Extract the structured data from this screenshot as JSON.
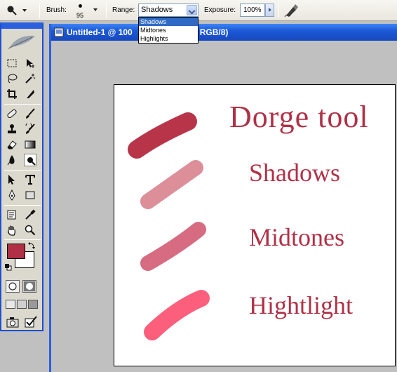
{
  "options_bar": {
    "tool_preset_icon": "dodge-tool-icon",
    "brush_label": "Brush:",
    "brush_size": "95",
    "range_label": "Range:",
    "range_value": "Shadows",
    "range_options": [
      "Shadows",
      "Midtones",
      "Highlights"
    ],
    "exposure_label": "Exposure:",
    "exposure_value": "100%",
    "airbrush_icon": "airbrush-icon"
  },
  "document": {
    "title": "Untitled-1 @ 100",
    "title_tail": "RGB/8)"
  },
  "canvas": {
    "heading": "Dorge  tool",
    "labels": [
      "Shadows",
      "Midtones",
      "Hightlight"
    ],
    "stroke_colors": [
      "#b83549",
      "#dc8f99",
      "#d66b81",
      "#fb5f7c"
    ]
  },
  "colors": {
    "foreground": "#b03146",
    "background": "#ffffff",
    "accent_text": "#b03146",
    "titlebar": "#1f5fd8"
  }
}
